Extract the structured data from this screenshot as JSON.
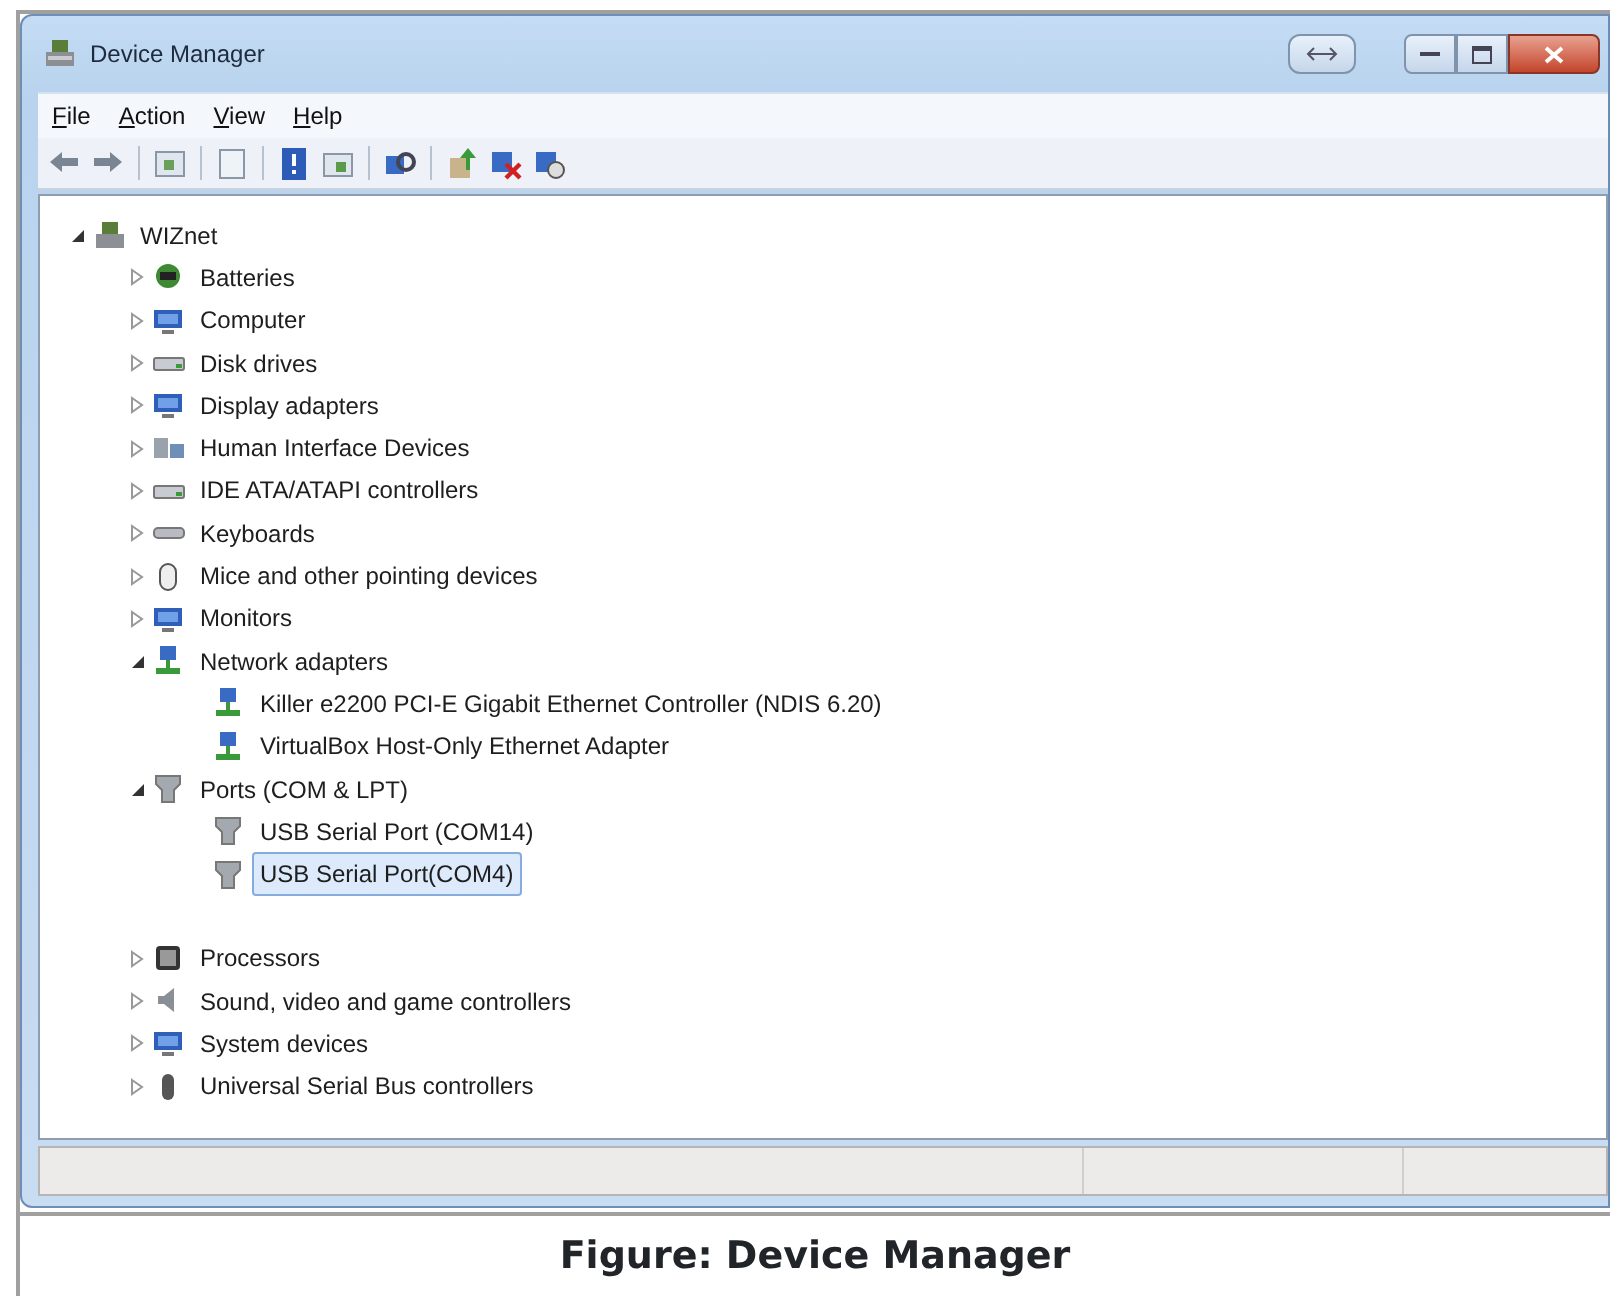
{
  "window": {
    "title": "Device Manager"
  },
  "menu": [
    {
      "label": "File"
    },
    {
      "label": "Action"
    },
    {
      "label": "View"
    },
    {
      "label": "Help"
    }
  ],
  "tree": [
    {
      "label": "WIZnet",
      "expanded": true,
      "selected": false,
      "children": [
        {
          "label": "Batteries",
          "expanded": false,
          "selected": false
        },
        {
          "label": "Computer",
          "expanded": false,
          "selected": false
        },
        {
          "label": "Disk drives",
          "expanded": false,
          "selected": false
        },
        {
          "label": "Display adapters",
          "expanded": false,
          "selected": false
        },
        {
          "label": "Human Interface Devices",
          "expanded": false,
          "selected": false
        },
        {
          "label": "IDE ATA/ATAPI controllers",
          "expanded": false,
          "selected": false
        },
        {
          "label": "Keyboards",
          "expanded": false,
          "selected": false
        },
        {
          "label": "Mice and other pointing devices",
          "expanded": false,
          "selected": false
        },
        {
          "label": "Monitors",
          "expanded": false,
          "selected": false
        },
        {
          "label": "Network adapters",
          "expanded": true,
          "selected": false,
          "children": [
            {
              "label": "Killer e2200 PCI-E Gigabit Ethernet Controller (NDIS 6.20)",
              "selected": false
            },
            {
              "label": "VirtualBox Host-Only Ethernet Adapter",
              "selected": false
            }
          ]
        },
        {
          "label": "Ports (COM & LPT)",
          "expanded": true,
          "selected": false,
          "children": [
            {
              "label": "USB Serial Port (COM14)",
              "selected": false
            },
            {
              "label": "USB Serial Port(COM4)",
              "selected": true
            }
          ]
        },
        {
          "label": "Processors",
          "expanded": false,
          "selected": false
        },
        {
          "label": "Sound, video and game controllers",
          "expanded": false,
          "selected": false
        },
        {
          "label": "System devices",
          "expanded": false,
          "selected": false
        },
        {
          "label": "Universal Serial Bus controllers",
          "expanded": false,
          "selected": false
        }
      ]
    }
  ],
  "caption": "Figure: Device Manager"
}
